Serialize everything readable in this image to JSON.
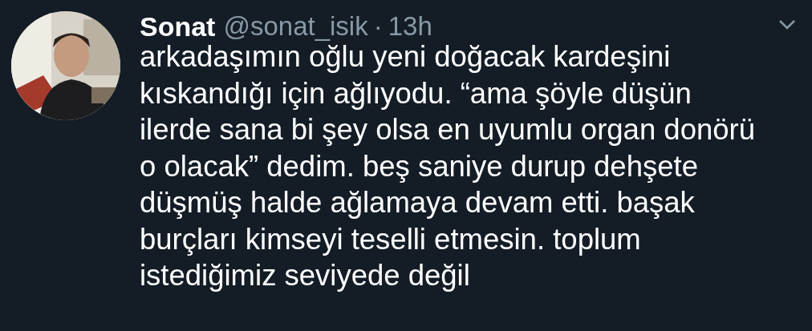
{
  "tweet": {
    "author": {
      "name": "Sonat",
      "handle": "@sonat_isik",
      "separator": "·",
      "time": "13h"
    },
    "menu_button": {
      "kind": "chevron"
    },
    "text": "arkadaşımın oğlu yeni doğacak kardeşini\nkıskandığı için ağlıyodu. “ama şöyle düşün\nilerde sana bi şey olsa en uyumlu organ donörü\no olacak” dedim. beş saniye durup dehşete\ndüşmüş halde ağlamaya devam etti. başak\nburçları kimseyi teselli etmesin. toplum\nistediğimiz seviyede değil"
  }
}
